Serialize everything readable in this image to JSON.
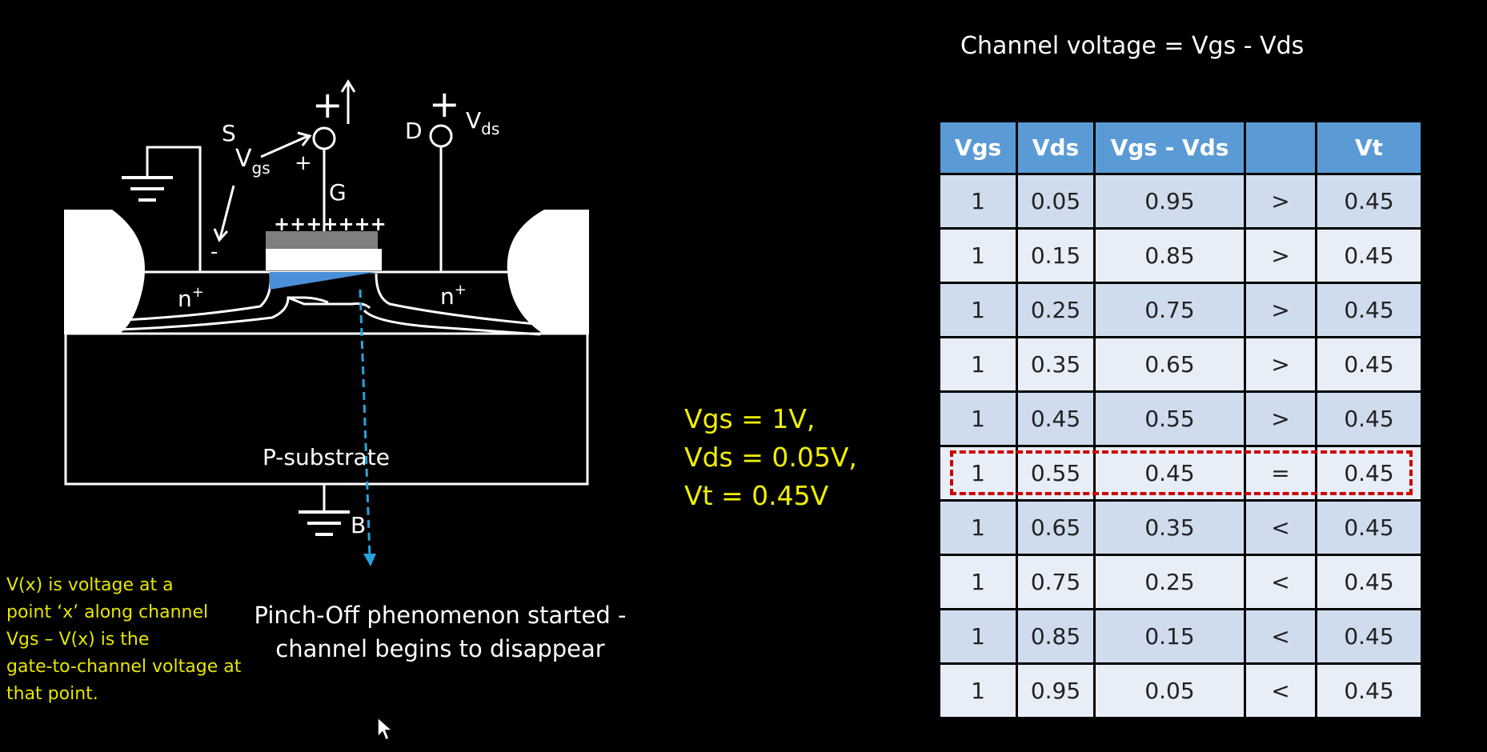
{
  "title": "Channel voltage = Vgs - Vds",
  "diagram": {
    "source_label": "S",
    "gate_label": "G",
    "drain_label": "D",
    "bulk_label": "B",
    "vgs_symbol": "V",
    "vgs_sub": "gs",
    "vds_symbol": "V",
    "vds_sub": "ds",
    "plus": "+",
    "minus": "-",
    "gate_charges": "+++++++",
    "n_plus_left": "n",
    "n_plus_right": "n",
    "n_sup": "+",
    "substrate": "P-substrate"
  },
  "params": [
    "Vgs = 1V,",
    "Vds = 0.05V,",
    "Vt = 0.45V"
  ],
  "note": [
    "V(x) is voltage at a",
    "point ‘x’ along channel",
    "Vgs – V(x) is the",
    "gate-to-channel voltage at",
    "that point."
  ],
  "caption": [
    "Pinch-Off phenomenon started -",
    "channel begins to disappear"
  ],
  "table": {
    "headers": [
      "Vgs",
      "Vds",
      "Vgs - Vds",
      "",
      "Vt"
    ],
    "rows": [
      [
        "1",
        "0.05",
        "0.95",
        ">",
        "0.45"
      ],
      [
        "1",
        "0.15",
        "0.85",
        ">",
        "0.45"
      ],
      [
        "1",
        "0.25",
        "0.75",
        ">",
        "0.45"
      ],
      [
        "1",
        "0.35",
        "0.65",
        ">",
        "0.45"
      ],
      [
        "1",
        "0.45",
        "0.55",
        ">",
        "0.45"
      ],
      [
        "1",
        "0.55",
        "0.45",
        "=",
        "0.45"
      ],
      [
        "1",
        "0.65",
        "0.35",
        "<",
        "0.45"
      ],
      [
        "1",
        "0.75",
        "0.25",
        "<",
        "0.45"
      ],
      [
        "1",
        "0.85",
        "0.15",
        "<",
        "0.45"
      ],
      [
        "1",
        "0.95",
        "0.05",
        "<",
        "0.45"
      ]
    ],
    "highlighted_row": 5
  },
  "colors": {
    "header_bg": "#5b9bd5",
    "row_dark": "#cfdcee",
    "row_light": "#e8eef7",
    "highlight_border": "#cc0000",
    "yellow_text": "#f0f000",
    "channel_blue": "#4a8fd8",
    "arrow_blue": "#29a3e0"
  }
}
